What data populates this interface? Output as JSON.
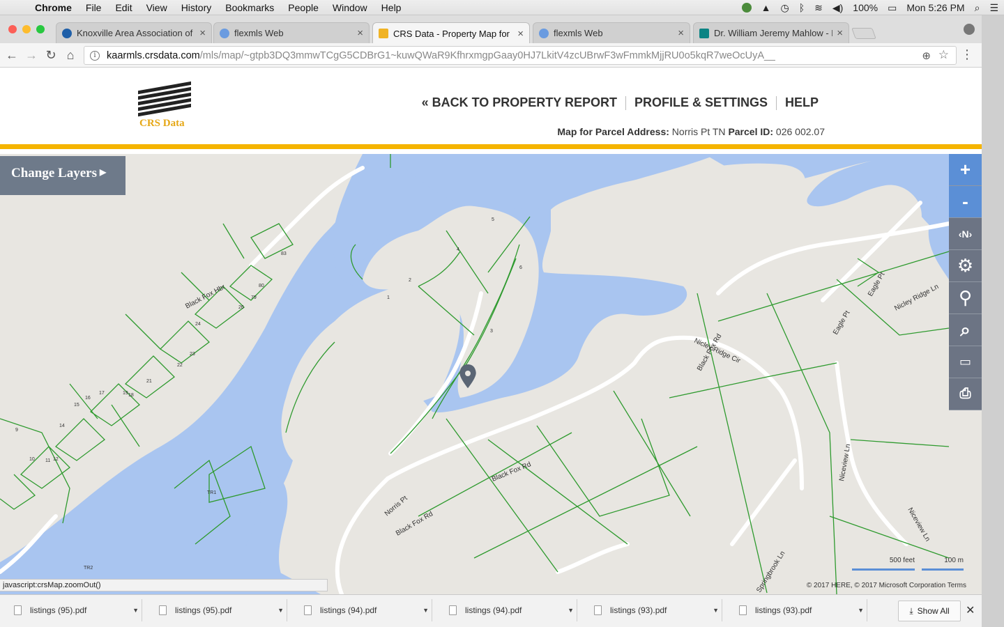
{
  "menubar": {
    "app": "Chrome",
    "items": [
      "File",
      "Edit",
      "View",
      "History",
      "Bookmarks",
      "People",
      "Window",
      "Help"
    ],
    "battery": "100%",
    "clock": "Mon 5:26 PM"
  },
  "tabs": [
    {
      "title": "Knoxville Area Association of"
    },
    {
      "title": "flexmls Web"
    },
    {
      "title": "CRS Data - Property Map for"
    },
    {
      "title": "flexmls Web"
    },
    {
      "title": "Dr. William Jeremy Mahlow - E"
    }
  ],
  "address": {
    "host": "kaarmls.crsdata.com",
    "path": "/mls/map/~gtpb3DQ3mmwTCgG5CDBrG1~kuwQWaR9KfhrxmgpGaay0HJ7LkitV4zcUBrwF3wFmmkMjjRU0o5kqR7weOcUyA__"
  },
  "site": {
    "brand": "CRS Data",
    "nav": {
      "back": "« BACK TO PROPERTY REPORT",
      "profile": "PROFILE & SETTINGS",
      "help": "HELP"
    },
    "parcel": {
      "address_label": "Map for Parcel Address:",
      "address_value": "Norris Pt TN",
      "id_label": "Parcel ID:",
      "id_value": "026 002.07"
    }
  },
  "map": {
    "change_layers": "Change Layers",
    "tools": {
      "zoom_in": "+",
      "zoom_out": "-",
      "north": "N"
    },
    "road_labels": [
      "Black Fox Hbr",
      "Norris Pt",
      "Black Fox Rd",
      "Black Fox Rd",
      "Nicley Ridge Cir",
      "Black Fox Rd",
      "Eagle Pt",
      "Eagle Pt",
      "Nicley Ridge Ln",
      "Niceview Ln",
      "Niceview Ln",
      "Springbrook Ln"
    ],
    "lot_numbers": [
      "1",
      "2",
      "3",
      "4",
      "5",
      "6",
      "9",
      "10",
      "11",
      "12",
      "14",
      "15",
      "16",
      "17",
      "18",
      "19",
      "21",
      "22",
      "23",
      "24",
      "26",
      "79",
      "80",
      "83",
      "TR1",
      "TR2"
    ],
    "scale": {
      "feet": "500 feet",
      "meters": "100 m"
    },
    "attribution": "© 2017 HERE, © 2017 Microsoft Corporation  Terms",
    "colors": {
      "water": "#a9c5f0",
      "land": "#e8e6e1",
      "parcel_line": "#2e9a2e",
      "road": "#ffffff"
    }
  },
  "status_url": "javascript:crsMap.zoomOut()",
  "downloads": {
    "items": [
      "listings (95).pdf",
      "listings (95).pdf",
      "listings (94).pdf",
      "listings (94).pdf",
      "listings (93).pdf",
      "listings (93).pdf"
    ],
    "show_all": "Show All"
  }
}
